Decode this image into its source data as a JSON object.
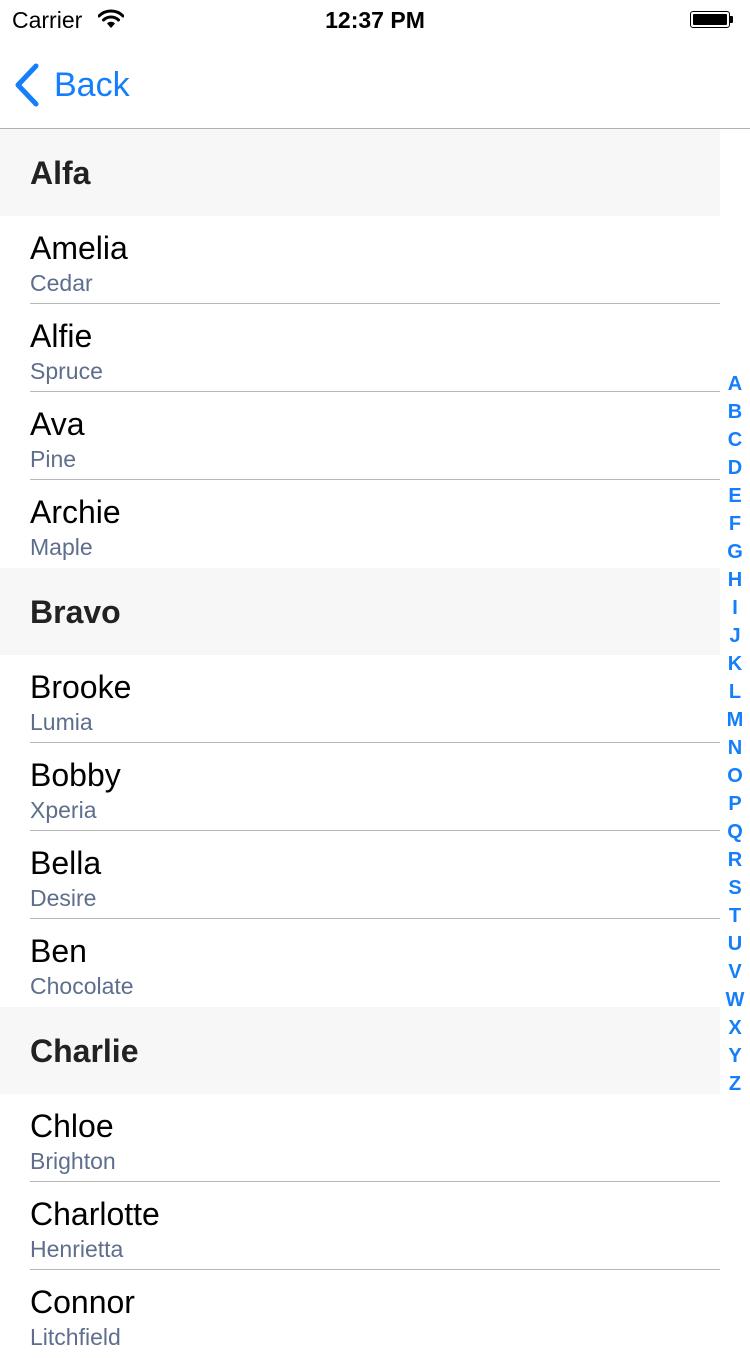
{
  "status_bar": {
    "carrier": "Carrier",
    "time": "12:37 PM"
  },
  "nav": {
    "back_label": "Back"
  },
  "sections": [
    {
      "title": "Alfa",
      "rows": [
        {
          "title": "Amelia",
          "subtitle": "Cedar"
        },
        {
          "title": "Alfie",
          "subtitle": "Spruce"
        },
        {
          "title": "Ava",
          "subtitle": "Pine"
        },
        {
          "title": "Archie",
          "subtitle": "Maple"
        }
      ]
    },
    {
      "title": "Bravo",
      "rows": [
        {
          "title": "Brooke",
          "subtitle": "Lumia"
        },
        {
          "title": "Bobby",
          "subtitle": "Xperia"
        },
        {
          "title": "Bella",
          "subtitle": "Desire"
        },
        {
          "title": "Ben",
          "subtitle": "Chocolate"
        }
      ]
    },
    {
      "title": "Charlie",
      "rows": [
        {
          "title": "Chloe",
          "subtitle": "Brighton"
        },
        {
          "title": "Charlotte",
          "subtitle": "Henrietta"
        },
        {
          "title": "Connor",
          "subtitle": "Litchfield"
        }
      ]
    }
  ],
  "section_index": [
    "A",
    "B",
    "C",
    "D",
    "E",
    "F",
    "G",
    "H",
    "I",
    "J",
    "K",
    "L",
    "M",
    "N",
    "O",
    "P",
    "Q",
    "R",
    "S",
    "T",
    "U",
    "V",
    "W",
    "X",
    "Y",
    "Z"
  ],
  "colors": {
    "accent": "#157efb",
    "subtitle": "#5e6e8c",
    "section_bg": "#f7f7f7"
  }
}
